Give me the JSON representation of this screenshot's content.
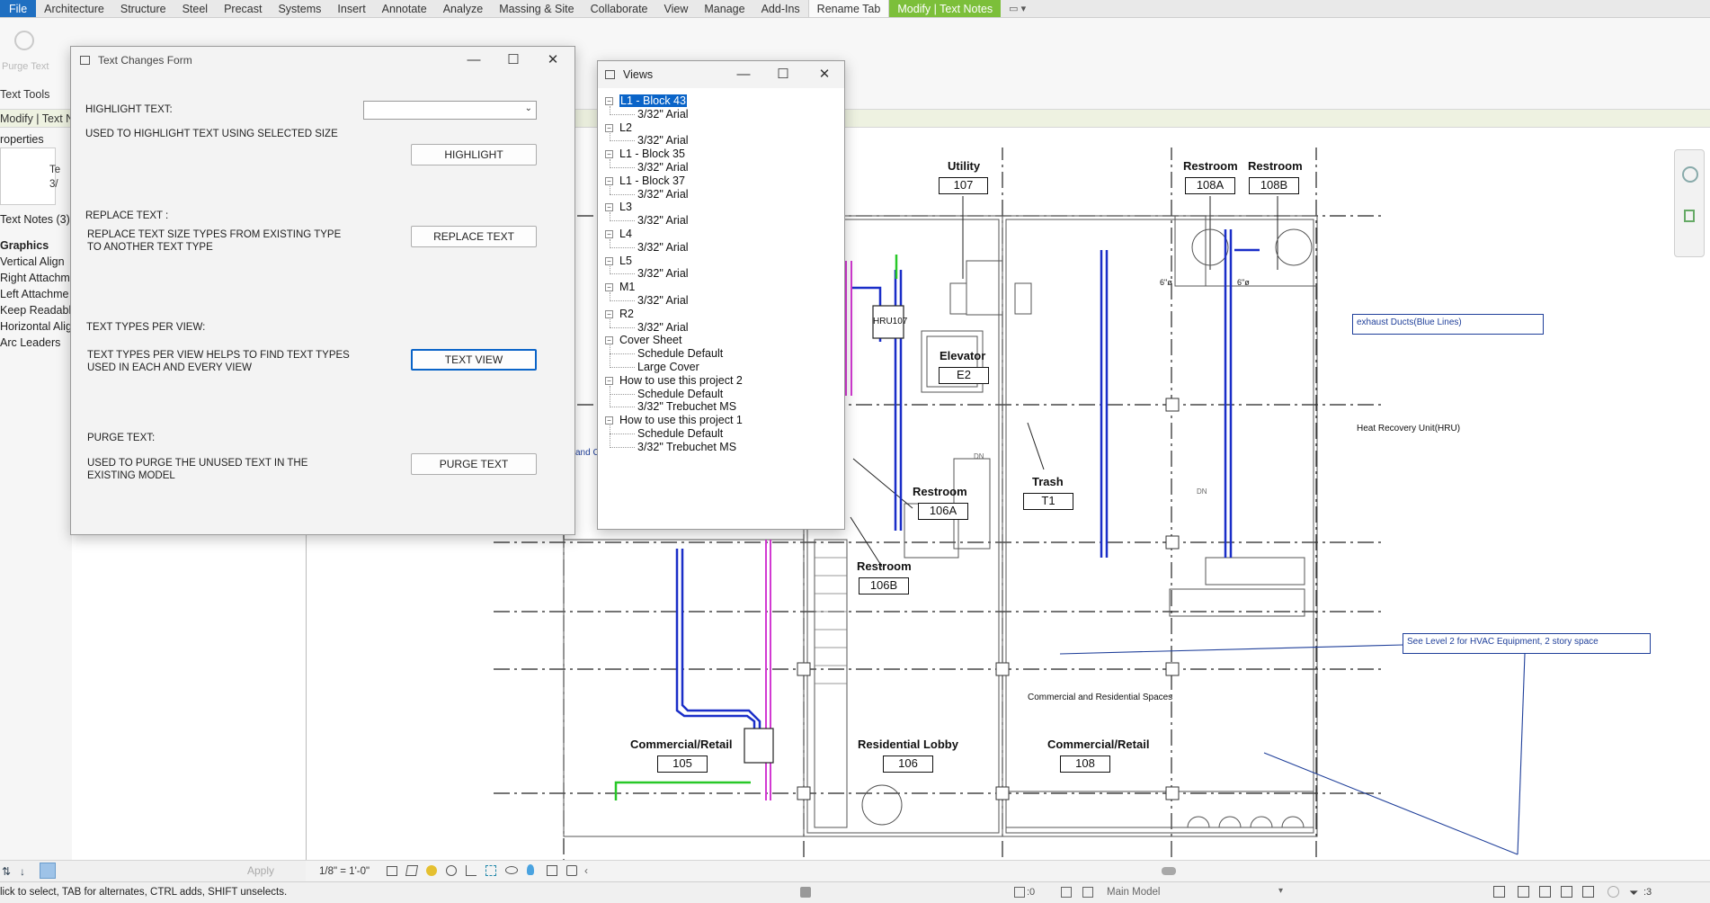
{
  "ribbon_tabs": [
    "File",
    "Architecture",
    "Structure",
    "Steel",
    "Precast",
    "Systems",
    "Insert",
    "Annotate",
    "Analyze",
    "Massing & Site",
    "Collaborate",
    "View",
    "Manage",
    "Add-Ins",
    "Rename Tab",
    "Modify | Text Notes"
  ],
  "ribbon": {
    "purge_text_label": "Purge Text",
    "panel_label": "Text Tools"
  },
  "context_bar": {
    "label": "Modify | Text N"
  },
  "properties": {
    "header": "roperties",
    "type_line1": "Te",
    "type_line2": "3/",
    "selector": "Text Notes (3)",
    "group": "Graphics",
    "params": [
      "Vertical Align",
      "Right Attachm",
      "Left Attachme",
      "Keep Readable",
      "Horizontal Alig",
      "Arc Leaders"
    ],
    "apply_label": "Apply"
  },
  "text_form": {
    "title": "Text Changes Form",
    "highlight_heading": "HIGHLIGHT TEXT:",
    "highlight_desc": "USED  TO  HIGHLIGHT TEXT USING SELECTED SIZE",
    "highlight_button": "HIGHLIGHT",
    "highlight_select_value": "",
    "replace_heading": "REPLACE TEXT :",
    "replace_desc": "REPLACE TEXT SIZE TYPES FROM EXISTING TYPE TO ANOTHER TEXT TYPE",
    "replace_button": "REPLACE TEXT",
    "types_heading": "TEXT TYPES PER VIEW:",
    "types_desc": "TEXT TYPES PER VIEW HELPS TO FIND TEXT TYPES USED IN EACH AND EVERY VIEW",
    "types_button": "TEXT VIEW",
    "purge_heading": "PURGE TEXT:",
    "purge_desc": "USED TO PURGE THE UNUSED TEXT IN THE EXISTING MODEL",
    "purge_button": "PURGE TEXT"
  },
  "views_window": {
    "title": "Views",
    "tree": [
      {
        "label": "L1 - Block 43",
        "selected": true,
        "children": [
          "3/32\" Arial"
        ]
      },
      {
        "label": "L2",
        "children": [
          "3/32\" Arial"
        ]
      },
      {
        "label": "L1 - Block 35",
        "children": [
          "3/32\" Arial"
        ]
      },
      {
        "label": "L1 - Block 37",
        "children": [
          "3/32\" Arial"
        ]
      },
      {
        "label": "L3",
        "children": [
          "3/32\" Arial"
        ]
      },
      {
        "label": "L4",
        "children": [
          "3/32\" Arial"
        ]
      },
      {
        "label": "L5",
        "children": [
          "3/32\" Arial"
        ]
      },
      {
        "label": "M1",
        "children": [
          "3/32\" Arial"
        ]
      },
      {
        "label": "R2",
        "children": [
          "3/32\" Arial"
        ]
      },
      {
        "label": "Cover Sheet",
        "children": [
          "Schedule Default",
          "Large Cover"
        ]
      },
      {
        "label": "How to use this project 2",
        "children": [
          "Schedule Default",
          "3/32\" Trebuchet MS"
        ]
      },
      {
        "label": "How to use this project 1",
        "children": [
          "Schedule Default",
          "3/32\" Trebuchet MS"
        ]
      }
    ]
  },
  "drawing": {
    "rooms": [
      {
        "name": "Utility",
        "number": "107"
      },
      {
        "name": "Restroom",
        "number": "108A"
      },
      {
        "name": "Restroom",
        "number": "108B"
      },
      {
        "name": "Elevator",
        "number": "E2"
      },
      {
        "name": "Restroom",
        "number": "106A"
      },
      {
        "name": "Trash",
        "number": "T1"
      },
      {
        "name": "Restroom",
        "number": "106B"
      },
      {
        "name": "Commercial/Retail",
        "number": "105"
      },
      {
        "name": "Residential Lobby",
        "number": "106"
      },
      {
        "name": "Commercial/Retail",
        "number": "108"
      }
    ],
    "notes": {
      "exhaust": "exhaust Ducts(Blue Lines)",
      "hru": "Heat Recovery Unit(HRU)",
      "hvac": "See Level 2 for HVAC Equipment, 2 story space",
      "spaces": "Commercial and Residential Spaces",
      "hru_tag": "HRU107",
      "cut_text": "and C",
      "duct_label": "6\"ø",
      "dn": "DN"
    }
  },
  "view_control": {
    "scale": "1/8\" = 1'-0\""
  },
  "status_bar": {
    "hint": "lick to select, TAB for alternates, CTRL adds, SHIFT unselects.",
    "selection_count": ":0",
    "model": "Main Model",
    "filter_count": ":3"
  },
  "colors": {
    "file_tab": "#1f6fc1",
    "context_tab": "#7cbf3a",
    "selection": "#0a64c8",
    "duct_blue": "#1a2ec8",
    "duct_magenta": "#d23ad2",
    "duct_green": "#28c828"
  }
}
